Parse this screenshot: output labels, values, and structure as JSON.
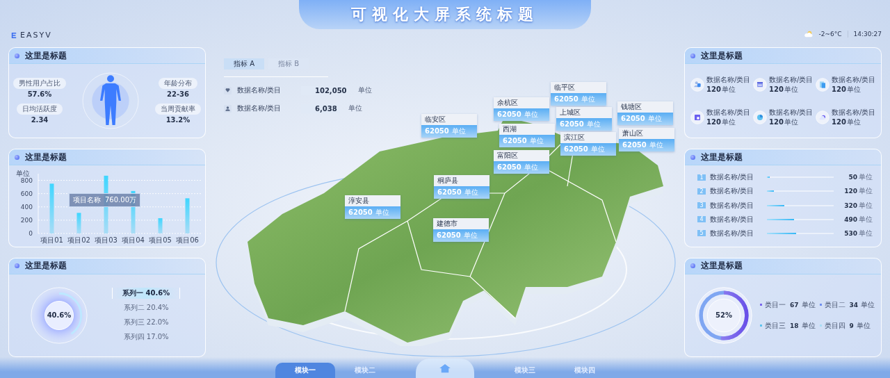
{
  "header": {
    "logo": "EASYV",
    "title": "可视化大屏系统标题",
    "weather": "-2~6°C",
    "time": "14:30:27"
  },
  "profile_panel": {
    "title": "这里是标题",
    "stats": [
      {
        "label": "男性用户占比",
        "value": "57.6%"
      },
      {
        "label": "日均活跃度",
        "value": "2.34"
      },
      {
        "label": "年龄分布",
        "value": "22-36"
      },
      {
        "label": "当周贡献率",
        "value": "13.2%"
      }
    ]
  },
  "bar_panel": {
    "title": "这里是标题",
    "tooltip": {
      "label": "项目名称",
      "value": "760.00万"
    },
    "chart_data": {
      "type": "bar",
      "ylabel": "单位",
      "categories": [
        "项目01",
        "项目02",
        "项目03",
        "项目04",
        "项目05",
        "项目06"
      ],
      "values": [
        750,
        310,
        870,
        640,
        230,
        530
      ],
      "ylim": [
        0,
        900
      ],
      "grid": true,
      "yticks": [
        0,
        200,
        400,
        600,
        800
      ]
    }
  },
  "donut_panel": {
    "title": "这里是标题",
    "center": "40.6%",
    "level": 0.406,
    "legend": [
      {
        "label": "系列一 40.6%",
        "selected": true
      },
      {
        "label": "系列二 20.4%",
        "selected": false
      },
      {
        "label": "系列三 22.0%",
        "selected": false
      },
      {
        "label": "系列四 17.0%",
        "selected": false
      }
    ]
  },
  "tabs": [
    {
      "label": "指标 A",
      "selected": true
    },
    {
      "label": "指标 B",
      "selected": false
    }
  ],
  "summary": [
    {
      "kind": "diamond",
      "label": "数据名称/类目",
      "value": "102,050",
      "unit": "单位"
    },
    {
      "kind": "person",
      "label": "数据名称/类目",
      "value": "6,038",
      "unit": "单位"
    }
  ],
  "map": {
    "regions": [
      {
        "name": "临平区",
        "value": "62050",
        "unit": "单位"
      },
      {
        "name": "余杭区",
        "value": "62050",
        "unit": "单位"
      },
      {
        "name": "上城区",
        "value": "62050",
        "unit": "单位"
      },
      {
        "name": "钱塘区",
        "value": "62050",
        "unit": "单位"
      },
      {
        "name": "西湖",
        "value": "62050",
        "unit": "单位"
      },
      {
        "name": "滨江区",
        "value": "62050",
        "unit": "单位"
      },
      {
        "name": "萧山区",
        "value": "62050",
        "unit": "单位"
      },
      {
        "name": "临安区",
        "value": "62050",
        "unit": "单位"
      },
      {
        "name": "富阳区",
        "value": "62050",
        "unit": "单位"
      },
      {
        "name": "桐庐县",
        "value": "62050",
        "unit": "单位"
      },
      {
        "name": "淳安县",
        "value": "62050",
        "unit": "单位"
      },
      {
        "name": "建德市",
        "value": "62050",
        "unit": "单位"
      }
    ]
  },
  "stat_panel": {
    "title": "这里是标题",
    "items": [
      {
        "kind": "users",
        "label": "数据名称/类目",
        "value": "120",
        "unit": "单位"
      },
      {
        "kind": "calendar",
        "label": "数据名称/类目",
        "value": "120",
        "unit": "单位"
      },
      {
        "kind": "document",
        "label": "数据名称/类目",
        "value": "120",
        "unit": "单位"
      },
      {
        "kind": "window",
        "label": "数据名称/类目",
        "value": "120",
        "unit": "单位"
      },
      {
        "kind": "pie",
        "label": "数据名称/类目",
        "value": "120",
        "unit": "单位"
      },
      {
        "kind": "cloud",
        "label": "数据名称/类目",
        "value": "120",
        "unit": "单位"
      }
    ]
  },
  "rank_panel": {
    "title": "这里是标题",
    "rows": [
      {
        "index": "1",
        "label": "数据名称/类目",
        "level": 0.04,
        "value": "50",
        "unit": "单位"
      },
      {
        "index": "2",
        "label": "数据名称/类目",
        "level": 0.1,
        "value": "120",
        "unit": "单位"
      },
      {
        "index": "3",
        "label": "数据名称/类目",
        "level": 0.26,
        "value": "320",
        "unit": "单位"
      },
      {
        "index": "4",
        "label": "数据名称/类目",
        "level": 0.41,
        "value": "490",
        "unit": "单位"
      },
      {
        "index": "5",
        "label": "数据名称/类目",
        "level": 0.44,
        "value": "530",
        "unit": "单位"
      }
    ]
  },
  "ring_panel": {
    "title": "这里是标题",
    "center": "52%",
    "level": 0.52,
    "legend": [
      {
        "label": "类目一",
        "value": "67",
        "unit": "单位",
        "color": "#7a66ee"
      },
      {
        "label": "类目二",
        "value": "34",
        "unit": "单位",
        "color": "#6f8ff0"
      },
      {
        "label": "类目三",
        "value": "18",
        "unit": "单位",
        "color": "#5cc4ef"
      },
      {
        "label": "类目四",
        "value": "9",
        "unit": "单位",
        "color": "#a9ddf5"
      }
    ]
  },
  "nav": {
    "left": [
      {
        "label": "模块一",
        "selected": true
      },
      {
        "label": "模块二",
        "selected": false
      }
    ],
    "right": [
      {
        "label": "模块三",
        "selected": false
      },
      {
        "label": "模块四",
        "selected": false
      }
    ]
  }
}
